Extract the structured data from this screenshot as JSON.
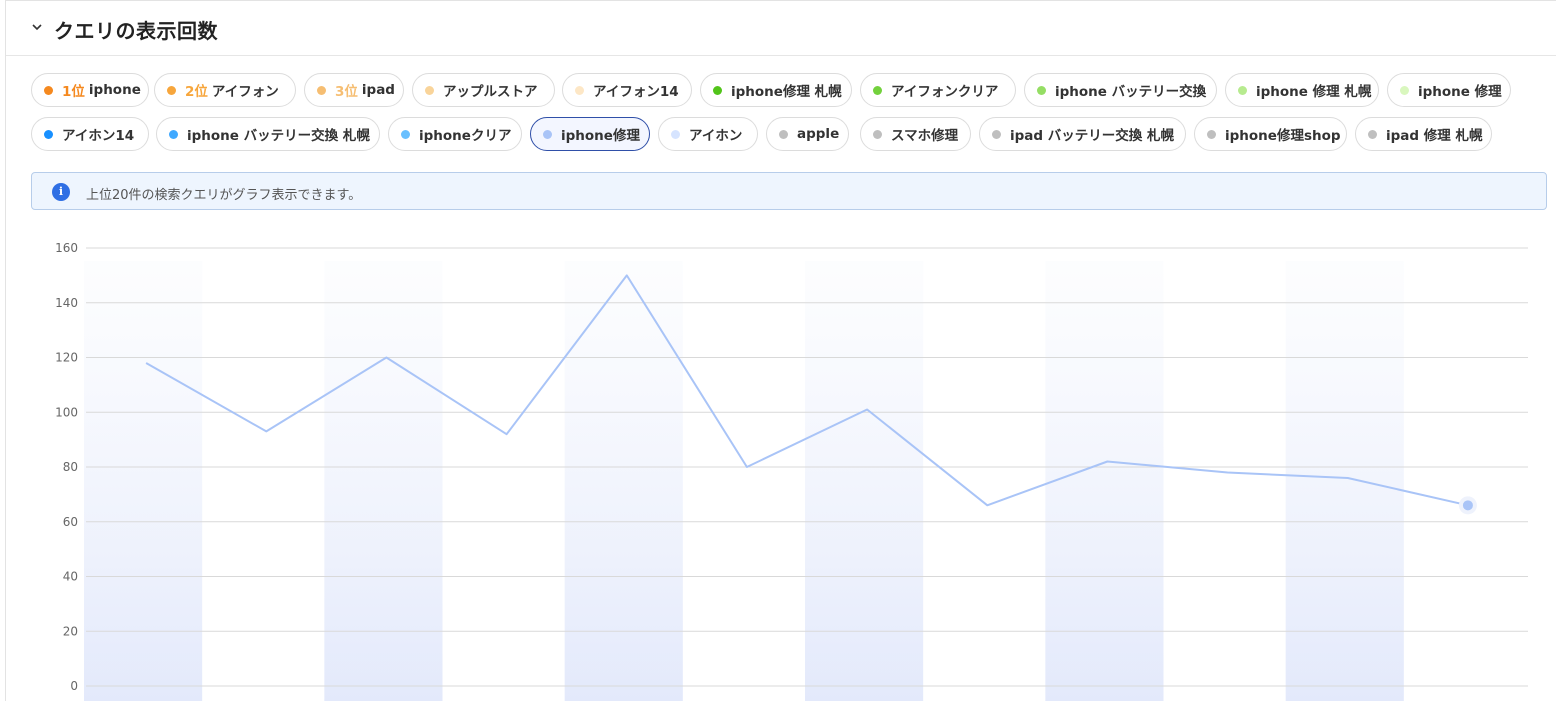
{
  "header": {
    "title": "クエリの表示回数",
    "collapse_icon": "chevron-down-icon"
  },
  "chips_row1": [
    {
      "rank": "1位",
      "label": "iphone",
      "color": "#f5891f",
      "rank_color": "#f5891f"
    },
    {
      "rank": "2位",
      "label": "アイフォン",
      "color": "#f7a63c",
      "rank_color": "#f7a63c"
    },
    {
      "rank": "3位",
      "label": "ipad",
      "color": "#f6be72",
      "rank_color": "#f6be72"
    },
    {
      "rank": "",
      "label": "アップルストア",
      "color": "#f9d49a"
    },
    {
      "rank": "",
      "label": "アイフォン14",
      "color": "#fde7c6"
    },
    {
      "rank": "",
      "label": "iphone修理 札幌",
      "color": "#52c41a"
    },
    {
      "rank": "",
      "label": "アイフォンクリア",
      "color": "#73d13d"
    },
    {
      "rank": "",
      "label": "iphone バッテリー交換",
      "color": "#95de64"
    },
    {
      "rank": "",
      "label": "iphone 修理 札幌",
      "color": "#b7eb8f"
    },
    {
      "rank": "",
      "label": "iphone 修理",
      "color": "#d9f7be"
    }
  ],
  "chips_row2": [
    {
      "label": "アイホン14",
      "color": "#1890ff"
    },
    {
      "label": "iphone バッテリー交換 札幌",
      "color": "#40a9ff"
    },
    {
      "label": "iphoneクリア",
      "color": "#69c0ff"
    },
    {
      "label": "iphone修理",
      "color": "#a9c4f7",
      "active": true
    },
    {
      "label": "アイホン",
      "color": "#d6e4ff"
    },
    {
      "label": "apple",
      "color": "#bfbfbf"
    },
    {
      "label": "スマホ修理",
      "color": "#bfbfbf"
    },
    {
      "label": "ipad バッテリー交換 札幌",
      "color": "#bfbfbf"
    },
    {
      "label": "iphone修理shop",
      "color": "#bfbfbf"
    },
    {
      "label": "ipad 修理 札幌",
      "color": "#bfbfbf"
    }
  ],
  "info": {
    "icon": "info-icon",
    "text": "上位20件の検索クエリがグラフ表示できます。"
  },
  "chart_data": {
    "type": "line",
    "title": "",
    "xlabel": "",
    "ylabel": "",
    "ylim": [
      0,
      160
    ],
    "yticks": [
      "0",
      "20",
      "40",
      "60",
      "80",
      "100",
      "120",
      "140",
      "160"
    ],
    "grid": true,
    "series": [
      {
        "name": "iphone修理",
        "color": "#a9c4f7",
        "values": [
          118,
          93,
          120,
          92,
          150,
          80,
          101,
          66,
          82,
          78,
          76,
          66
        ]
      }
    ]
  }
}
